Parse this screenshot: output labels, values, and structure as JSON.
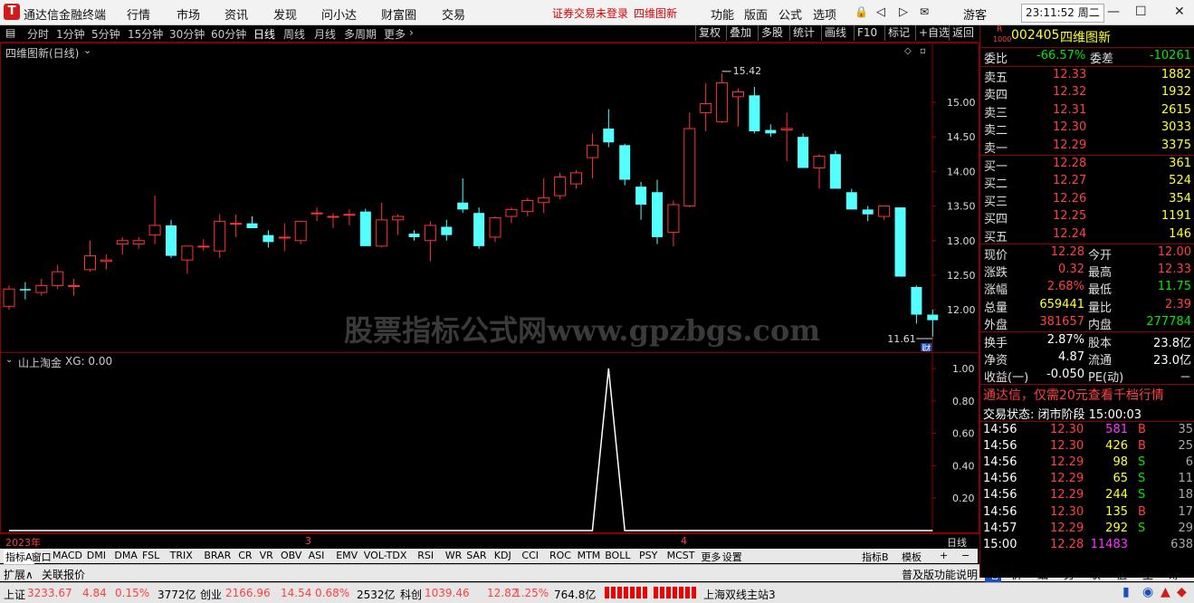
{
  "titlebar": {
    "app_title": "通达信金融终端",
    "menu": [
      "行情",
      "市场",
      "资讯",
      "发现",
      "问小达",
      "财富圈",
      "交易"
    ],
    "login_notice": "证券交易未登录",
    "stock_title": "四维图新",
    "right_menu": [
      "功能",
      "版面",
      "公式",
      "选项"
    ],
    "user": "游客",
    "clock": "23:11:52 周二"
  },
  "periodbar": {
    "periods": [
      "分时",
      "1分钟",
      "5分钟",
      "15分钟",
      "30分钟",
      "60分钟",
      "日线",
      "周线",
      "月线",
      "多周期",
      "更多"
    ],
    "active": "日线",
    "right_buttons": [
      "复权",
      "叠加",
      "多股",
      "统计",
      "画线",
      "F10",
      "标记",
      "+自选",
      "返回"
    ]
  },
  "main_chart": {
    "title": "四维图新(日线)",
    "watermark": "股票指标公式网www.gpzbgs.com",
    "high_label": "15.42",
    "low_label": "11.61",
    "fin_badge": "财"
  },
  "chart_data": [
    {
      "type": "candlestick",
      "title": "四维图新(日线)",
      "ylim": [
        11.4,
        15.85
      ],
      "yticks": [
        "15.00",
        "14.50",
        "14.00",
        "13.50",
        "13.00",
        "12.50",
        "12.00"
      ],
      "x_labels": [
        "2023年",
        "3",
        "4"
      ],
      "colors": {
        "up": "#ff3232",
        "down": "#54ffff",
        "grid": "#8b0000"
      },
      "candles": [
        {
          "o": 12.05,
          "h": 12.35,
          "l": 12.0,
          "c": 12.3
        },
        {
          "o": 12.3,
          "h": 12.4,
          "l": 12.15,
          "c": 12.28
        },
        {
          "o": 12.25,
          "h": 12.45,
          "l": 12.2,
          "c": 12.35
        },
        {
          "o": 12.35,
          "h": 12.65,
          "l": 12.3,
          "c": 12.55
        },
        {
          "o": 12.35,
          "h": 12.45,
          "l": 12.2,
          "c": 12.35
        },
        {
          "o": 12.58,
          "h": 13.0,
          "l": 12.55,
          "c": 12.78
        },
        {
          "o": 12.7,
          "h": 12.8,
          "l": 12.58,
          "c": 12.72
        },
        {
          "o": 12.95,
          "h": 13.05,
          "l": 12.8,
          "c": 13.0
        },
        {
          "o": 12.95,
          "h": 13.05,
          "l": 12.88,
          "c": 13.0
        },
        {
          "o": 13.08,
          "h": 13.65,
          "l": 12.95,
          "c": 13.22
        },
        {
          "o": 13.22,
          "h": 13.3,
          "l": 12.75,
          "c": 12.78
        },
        {
          "o": 12.72,
          "h": 12.92,
          "l": 12.52,
          "c": 12.92
        },
        {
          "o": 12.92,
          "h": 13.02,
          "l": 12.85,
          "c": 12.92
        },
        {
          "o": 12.85,
          "h": 13.38,
          "l": 12.75,
          "c": 13.28
        },
        {
          "o": 13.25,
          "h": 13.38,
          "l": 13.05,
          "c": 13.25
        },
        {
          "o": 13.25,
          "h": 13.35,
          "l": 13.18,
          "c": 13.18
        },
        {
          "o": 13.08,
          "h": 13.15,
          "l": 12.9,
          "c": 12.98
        },
        {
          "o": 13.05,
          "h": 13.25,
          "l": 12.85,
          "c": 13.05
        },
        {
          "o": 13.0,
          "h": 13.28,
          "l": 12.95,
          "c": 13.28
        },
        {
          "o": 13.4,
          "h": 13.48,
          "l": 13.28,
          "c": 13.4
        },
        {
          "o": 13.35,
          "h": 13.4,
          "l": 13.18,
          "c": 13.35
        },
        {
          "o": 13.38,
          "h": 13.45,
          "l": 13.22,
          "c": 13.38
        },
        {
          "o": 13.42,
          "h": 13.46,
          "l": 12.92,
          "c": 12.92
        },
        {
          "o": 12.92,
          "h": 13.55,
          "l": 12.9,
          "c": 13.3
        },
        {
          "o": 13.3,
          "h": 13.38,
          "l": 13.08,
          "c": 13.35
        },
        {
          "o": 13.1,
          "h": 13.15,
          "l": 13.0,
          "c": 13.05
        },
        {
          "o": 13.0,
          "h": 13.28,
          "l": 12.7,
          "c": 13.22
        },
        {
          "o": 13.2,
          "h": 13.3,
          "l": 13.0,
          "c": 13.08
        },
        {
          "o": 13.55,
          "h": 13.9,
          "l": 13.4,
          "c": 13.45
        },
        {
          "o": 13.4,
          "h": 13.48,
          "l": 12.88,
          "c": 12.92
        },
        {
          "o": 13.05,
          "h": 13.35,
          "l": 12.98,
          "c": 13.33
        },
        {
          "o": 13.35,
          "h": 13.48,
          "l": 13.25,
          "c": 13.45
        },
        {
          "o": 13.42,
          "h": 13.62,
          "l": 13.35,
          "c": 13.58
        },
        {
          "o": 13.55,
          "h": 13.9,
          "l": 13.4,
          "c": 13.62
        },
        {
          "o": 13.65,
          "h": 13.98,
          "l": 13.6,
          "c": 13.92
        },
        {
          "o": 13.82,
          "h": 14.02,
          "l": 13.75,
          "c": 13.98
        },
        {
          "o": 14.2,
          "h": 14.55,
          "l": 13.9,
          "c": 14.38
        },
        {
          "o": 14.62,
          "h": 14.9,
          "l": 14.35,
          "c": 14.42
        },
        {
          "o": 14.38,
          "h": 14.4,
          "l": 13.8,
          "c": 13.88
        },
        {
          "o": 13.78,
          "h": 13.85,
          "l": 13.3,
          "c": 13.52
        },
        {
          "o": 13.7,
          "h": 13.88,
          "l": 12.95,
          "c": 13.05
        },
        {
          "o": 13.12,
          "h": 13.58,
          "l": 12.92,
          "c": 13.52
        },
        {
          "o": 13.5,
          "h": 14.85,
          "l": 13.48,
          "c": 14.62
        },
        {
          "o": 14.85,
          "h": 15.28,
          "l": 14.58,
          "c": 14.98
        },
        {
          "o": 14.72,
          "h": 15.42,
          "l": 14.7,
          "c": 15.28
        },
        {
          "o": 15.08,
          "h": 15.2,
          "l": 14.65,
          "c": 15.15
        },
        {
          "o": 15.1,
          "h": 15.22,
          "l": 14.55,
          "c": 14.58
        },
        {
          "o": 14.6,
          "h": 14.68,
          "l": 14.5,
          "c": 14.55
        },
        {
          "o": 14.6,
          "h": 14.85,
          "l": 14.15,
          "c": 14.62
        },
        {
          "o": 14.5,
          "h": 14.55,
          "l": 14.05,
          "c": 14.05
        },
        {
          "o": 14.05,
          "h": 14.25,
          "l": 13.75,
          "c": 14.22
        },
        {
          "o": 14.25,
          "h": 14.3,
          "l": 13.75,
          "c": 13.75
        },
        {
          "o": 13.7,
          "h": 13.75,
          "l": 13.45,
          "c": 13.45
        },
        {
          "o": 13.45,
          "h": 13.5,
          "l": 13.28,
          "c": 13.38
        },
        {
          "o": 13.35,
          "h": 13.5,
          "l": 13.3,
          "c": 13.5
        },
        {
          "o": 13.48,
          "h": 13.48,
          "l": 12.48,
          "c": 12.48
        },
        {
          "o": 12.33,
          "h": 12.35,
          "l": 11.8,
          "c": 11.93
        },
        {
          "o": 11.93,
          "h": 12.0,
          "l": 11.61,
          "c": 11.85
        }
      ]
    },
    {
      "type": "line",
      "title": "山上淘金",
      "series": [
        {
          "name": "XG",
          "values": [
            0,
            0,
            0,
            0,
            0,
            0,
            0,
            0,
            0,
            0,
            0,
            0,
            0,
            0,
            0,
            0,
            0,
            0,
            0,
            0,
            0,
            0,
            0,
            0,
            0,
            0,
            0,
            0,
            0,
            0,
            0,
            0,
            0,
            0,
            0,
            0,
            0,
            1,
            0,
            0,
            0,
            0,
            0,
            0,
            0,
            0,
            0,
            0,
            0,
            0,
            0,
            0,
            0,
            0,
            0,
            0,
            0,
            0
          ]
        }
      ],
      "ylim": [
        0,
        1.05
      ],
      "yticks": [
        "1.00",
        "0.80",
        "0.60",
        "0.40",
        "0.20"
      ]
    }
  ],
  "indicator_panel": {
    "title": "山上淘金",
    "value_text": "XG: 0.00"
  },
  "quote": {
    "code": "002405",
    "name": "四维图新",
    "badge_r": "R",
    "badge_num": "1000",
    "weibi_label": "委比",
    "weibi": "-66.57%",
    "weicha_label": "委差",
    "weicha": "-10261",
    "asks": [
      {
        "label": "卖五",
        "price": "12.33",
        "vol": "1882"
      },
      {
        "label": "卖四",
        "price": "12.32",
        "vol": "1932"
      },
      {
        "label": "卖三",
        "price": "12.31",
        "vol": "2615"
      },
      {
        "label": "卖二",
        "price": "12.30",
        "vol": "3033"
      },
      {
        "label": "卖一",
        "price": "12.29",
        "vol": "3375"
      }
    ],
    "bids": [
      {
        "label": "买一",
        "price": "12.28",
        "vol": "361"
      },
      {
        "label": "买二",
        "price": "12.27",
        "vol": "524"
      },
      {
        "label": "买三",
        "price": "12.26",
        "vol": "354"
      },
      {
        "label": "买四",
        "price": "12.25",
        "vol": "1191"
      },
      {
        "label": "买五",
        "price": "12.24",
        "vol": "146"
      }
    ],
    "stats": [
      {
        "l1": "现价",
        "v1": "12.28",
        "c1": "red",
        "l2": "今开",
        "v2": "12.00",
        "c2": "red"
      },
      {
        "l1": "涨跌",
        "v1": "0.32",
        "c1": "red",
        "l2": "最高",
        "v2": "12.33",
        "c2": "red"
      },
      {
        "l1": "涨幅",
        "v1": "2.68%",
        "c1": "red",
        "l2": "最低",
        "v2": "11.75",
        "c2": "grn"
      },
      {
        "l1": "总量",
        "v1": "659441",
        "c1": "yel",
        "l2": "量比",
        "v2": "2.39",
        "c2": "red"
      },
      {
        "l1": "外盘",
        "v1": "381657",
        "c1": "red",
        "l2": "内盘",
        "v2": "277784",
        "c2": "grn"
      }
    ],
    "stats2": [
      {
        "l1": "换手",
        "v1": "2.87%",
        "l2": "股本",
        "v2": "23.8亿"
      },
      {
        "l1": "净资",
        "v1": "4.87",
        "l2": "流通",
        "v2": "23.0亿"
      },
      {
        "l1": "收益(一)",
        "v1": "-0.050",
        "l2": "PE(动)",
        "v2": "－"
      }
    ],
    "ad_text": "通达信，仅需20元查看千档行情",
    "trade_status": "交易状态: 闭市阶段 15:00:03",
    "ticks": [
      {
        "t": "14:56",
        "p": "12.30",
        "v": "581",
        "bs": "B",
        "n": "35",
        "vc": "mag",
        "pc": "red"
      },
      {
        "t": "14:56",
        "p": "12.30",
        "v": "426",
        "bs": "B",
        "n": "25",
        "vc": "yel",
        "pc": "red"
      },
      {
        "t": "14:56",
        "p": "12.29",
        "v": "98",
        "bs": "S",
        "n": "6",
        "vc": "yel",
        "pc": "red"
      },
      {
        "t": "14:56",
        "p": "12.29",
        "v": "65",
        "bs": "S",
        "n": "11",
        "vc": "yel",
        "pc": "red"
      },
      {
        "t": "14:56",
        "p": "12.29",
        "v": "244",
        "bs": "S",
        "n": "18",
        "vc": "yel",
        "pc": "red"
      },
      {
        "t": "14:56",
        "p": "12.30",
        "v": "135",
        "bs": "B",
        "n": "17",
        "vc": "yel",
        "pc": "red"
      },
      {
        "t": "14:57",
        "p": "12.29",
        "v": "292",
        "bs": "S",
        "n": "29",
        "vc": "yel",
        "pc": "red"
      },
      {
        "t": "15:00",
        "p": "12.28",
        "v": "11483",
        "bs": "",
        "n": "638",
        "vc": "mag",
        "pc": "red"
      }
    ]
  },
  "tabbar": {
    "tabs": [
      "指标A",
      "窗口",
      "MACD",
      "DMI",
      "DMA",
      "FSL",
      "TRIX",
      "BRAR",
      "CR",
      "VR",
      "OBV",
      "ASI",
      "EMV",
      "VOL-TDX",
      "RSI",
      "WR",
      "SAR",
      "KDJ",
      "CCI",
      "ROC",
      "MTM",
      "BOLL",
      "PSY",
      "MCST",
      "更多",
      "设置"
    ],
    "right": [
      "指标B",
      "模板",
      "+",
      "−"
    ],
    "period_label": "日线"
  },
  "bottombar2": {
    "left": [
      "扩展∧",
      "关联报价"
    ],
    "mid": "普及版功能说明",
    "right_tabs": [
      "笔",
      "价",
      "细",
      "势",
      "联",
      "值",
      "主",
      "筹"
    ]
  },
  "statusbar": {
    "items": [
      {
        "name": "上证",
        "price": "3233.67",
        "chg": "4.84",
        "pct": "0.15%",
        "amt": "3772亿"
      },
      {
        "name": "创业",
        "price": "2166.96",
        "chg": "14.54",
        "pct": "0.68%",
        "amt": "2532亿"
      },
      {
        "name": "科创",
        "price": "1039.46",
        "chg": "12.82",
        "pct": "1.25%",
        "amt": "764.8亿"
      }
    ],
    "server": "上海双线主站3"
  }
}
